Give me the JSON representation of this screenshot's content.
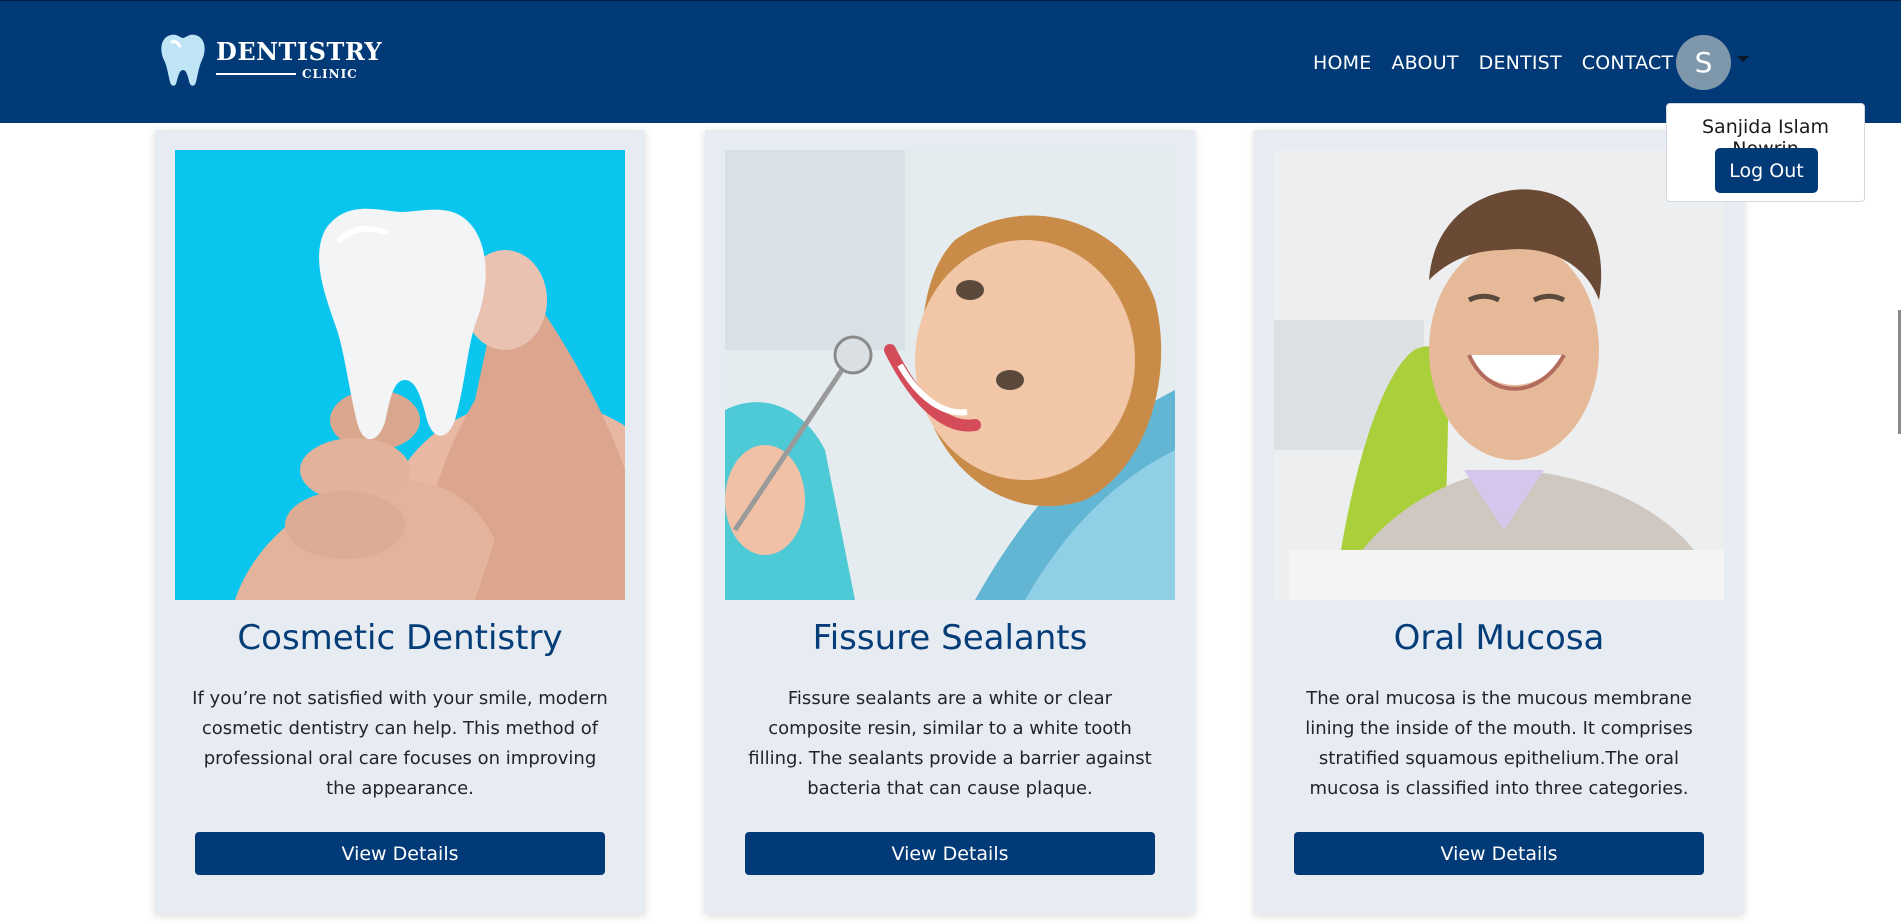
{
  "brand": {
    "title": "DENTISTRY",
    "subtitle": "CLINIC",
    "color": "#023a78"
  },
  "nav": {
    "links": [
      {
        "label": "HOME"
      },
      {
        "label": "ABOUT"
      },
      {
        "label": "DENTIST"
      },
      {
        "label": "CONTACT"
      }
    ],
    "avatar_initial": "S"
  },
  "user_menu": {
    "name": "Sanjida Islam Nowrin",
    "logout_label": "Log Out"
  },
  "services": [
    {
      "title": "Cosmetic Dentistry",
      "description": "If you’re not satisfied with your smile, modern cosmetic dentistry can help. This method of professional oral care focuses on improving the appearance.",
      "button_label": "View Details"
    },
    {
      "title": "Fissure Sealants",
      "description": "Fissure sealants are a white or clear composite resin, similar to a white tooth filling. The sealants provide a barrier against bacteria that can cause plaque.",
      "button_label": "View Details"
    },
    {
      "title": "Oral Mucosa",
      "description": "The oral mucosa is the mucous membrane lining the inside of the mouth. It comprises stratified squamous epithelium.The oral mucosa is classified into three categories.",
      "button_label": "View Details"
    }
  ]
}
